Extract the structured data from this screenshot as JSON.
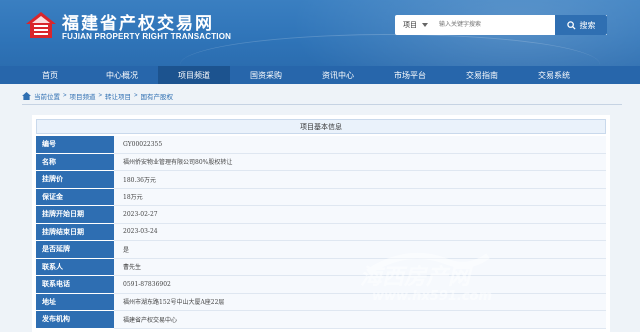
{
  "brand": {
    "title": "福建省产权交易网",
    "subtitle": "FUJIAN PROPERTY RIGHT TRANSACTION",
    "logo_icon": "house-logo-icon"
  },
  "search": {
    "type": "项目",
    "placeholder": "输入关键字搜索",
    "button_label": "搜索"
  },
  "nav": {
    "items": [
      {
        "label": "首页"
      },
      {
        "label": "中心概况"
      },
      {
        "label": "项目频道",
        "active": true
      },
      {
        "label": "国资采购"
      },
      {
        "label": "资讯中心"
      },
      {
        "label": "市场平台"
      },
      {
        "label": "交易指南"
      },
      {
        "label": "交易系统"
      }
    ]
  },
  "breadcrumb": {
    "items": [
      "当前位置",
      "项目频道",
      "转让项目",
      "国有产股权"
    ]
  },
  "detail": {
    "title": "项目基本信息",
    "rows": [
      {
        "label": "编号",
        "value": "GY00022355"
      },
      {
        "label": "名称",
        "value": "福州侨安物业管理有限公司80%股权转让"
      },
      {
        "label": "挂牌价",
        "value": "180.36万元"
      },
      {
        "label": "保证金",
        "value": "18万元"
      },
      {
        "label": "挂牌开始日期",
        "value": "2023-02-27"
      },
      {
        "label": "挂牌结束日期",
        "value": "2023-03-24"
      },
      {
        "label": "是否延牌",
        "value": "是"
      },
      {
        "label": "联系人",
        "value": "曹先生"
      },
      {
        "label": "联系电话",
        "value": "0591-87836902"
      },
      {
        "label": "地址",
        "value": "福州市湖东路152号中山大厦A座22层"
      },
      {
        "label": "发布机构",
        "value": "福建省产权交易中心"
      }
    ]
  },
  "watermark": {
    "text": "海西房产网",
    "url": "www.hx591.com"
  },
  "colors": {
    "header_blue": "#2f74b8",
    "nav_blue": "#2766ab",
    "nav_active": "#1c538f",
    "label_blue": "#2e6eb2",
    "logo_red": "#d9262c"
  }
}
